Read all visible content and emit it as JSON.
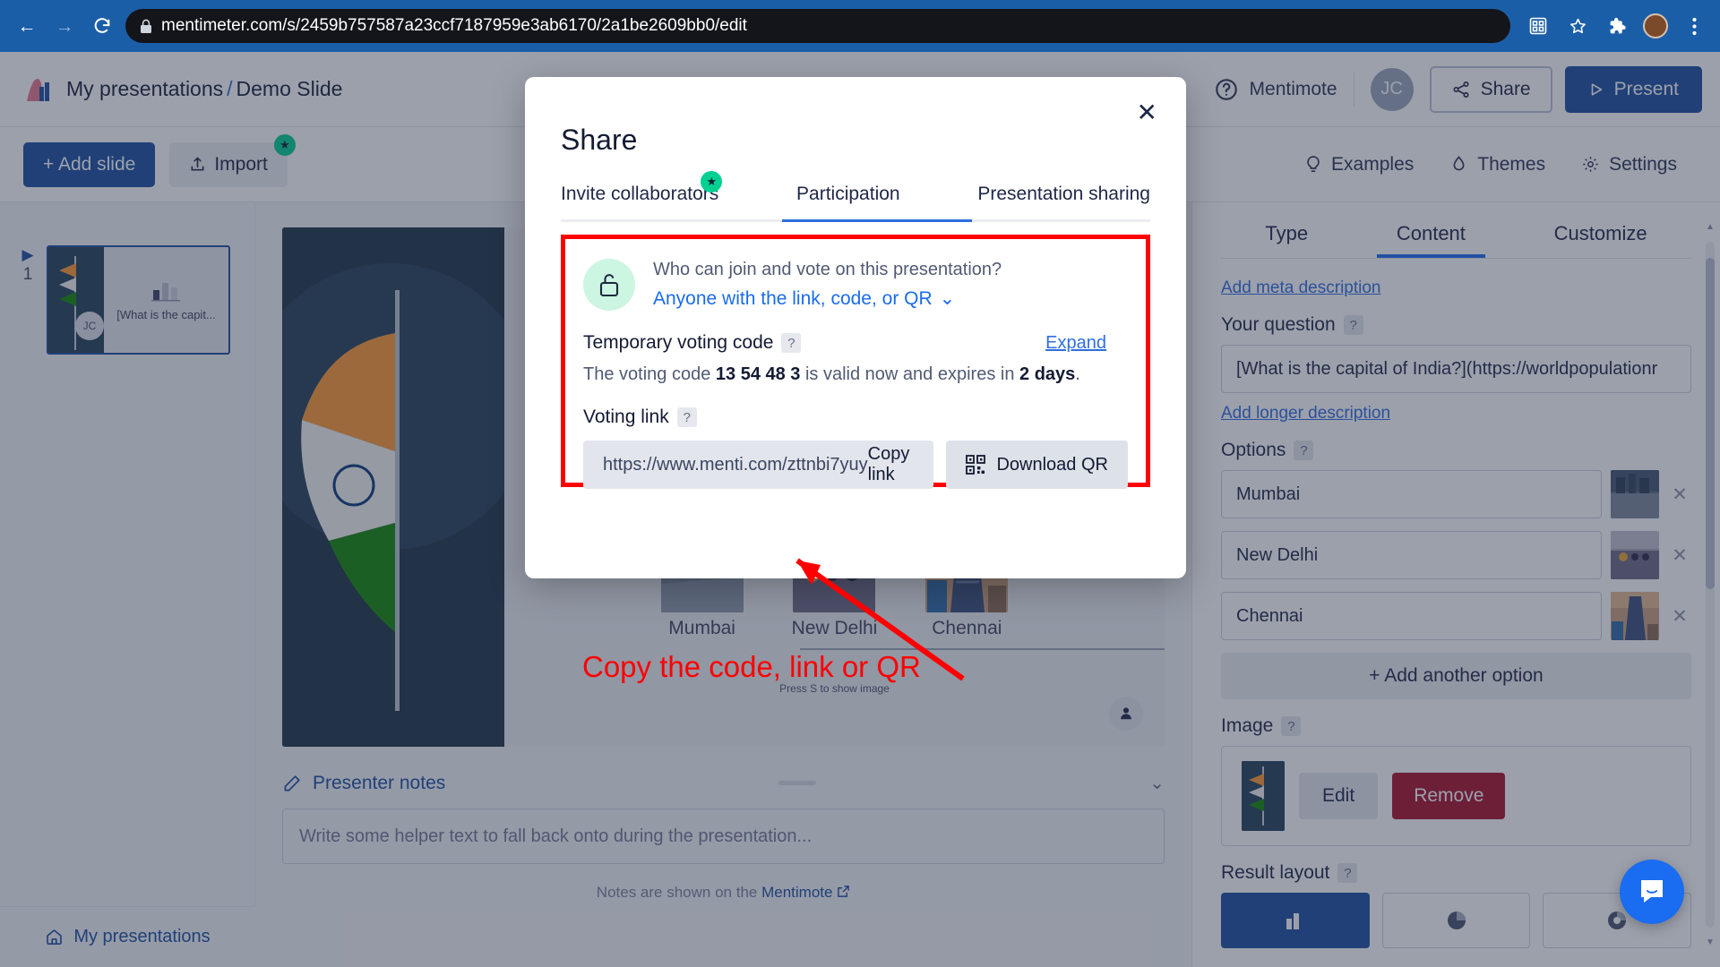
{
  "browser": {
    "url": "mentimeter.com/s/2459b757587a23ccf7187959e3ab6170/2a1be2609bb0/edit",
    "back_label": "←",
    "forward_label": "→",
    "reload_label": "C"
  },
  "header": {
    "breadcrumb_root": "My presentations",
    "breadcrumb_sep": "/",
    "breadcrumb_current": "Demo Slide",
    "mentimote_label": "Mentimote",
    "avatar_initials": "JC",
    "share_label": "Share",
    "present_label": "Present"
  },
  "toolbar": {
    "add_slide_label": "+ Add slide",
    "import_label": "Import",
    "examples_label": "Examples",
    "themes_label": "Themes",
    "settings_label": "Settings"
  },
  "slide_rail": {
    "slide_number": "1",
    "thumb_title": "[What is the capit...",
    "thumb_avatar": "JC",
    "my_presentations_label": "My presentations"
  },
  "editor": {
    "question_link": "[What is the capital of India?](https://worldpopulationreview.com)",
    "options": [
      {
        "label": "Mumbai"
      },
      {
        "label": "New Delhi"
      },
      {
        "label": "Chennai"
      }
    ],
    "press_s_hint": "Press S to show image",
    "notes_title": "Presenter notes",
    "notes_placeholder": "Write some helper text to fall back onto during the presentation...",
    "notes_footer_prefix": "Notes are shown on the",
    "notes_footer_link": "Mentimote"
  },
  "props": {
    "tabs": [
      {
        "label": "Type",
        "active": false
      },
      {
        "label": "Content",
        "active": true
      },
      {
        "label": "Customize",
        "active": false
      }
    ],
    "add_meta_description": "Add meta description",
    "your_question_label": "Your question",
    "your_question_value": "[What is the capital of India?](https://worldpopulationr",
    "add_longer_description": "Add longer description",
    "options_label": "Options",
    "options": [
      {
        "value": "Mumbai"
      },
      {
        "value": "New Delhi"
      },
      {
        "value": "Chennai"
      }
    ],
    "add_another_option": "+ Add another option",
    "image_label": "Image",
    "edit_label": "Edit",
    "remove_label": "Remove",
    "result_layout_label": "Result layout",
    "help_marker": "?"
  },
  "modal": {
    "title": "Share",
    "close_label": "✕",
    "tabs": [
      {
        "label": "Invite collaborators",
        "active": false,
        "badge": "★"
      },
      {
        "label": "Participation",
        "active": true
      },
      {
        "label": "Presentation sharing",
        "active": false
      }
    ],
    "who_question": "Who can join and vote on this presentation?",
    "who_answer": "Anyone with the link, code, or QR",
    "who_chevron": "⌄",
    "voting_code_label": "Temporary voting code",
    "expand_label": "Expand",
    "code_sentence_prefix": "The voting code",
    "code_value": "13 54 48 3",
    "code_sentence_mid": "is valid now and expires in",
    "code_expiry": "2 days",
    "code_sentence_suffix": ".",
    "voting_link_label": "Voting link",
    "voting_link_url": "https://www.menti.com/zttnbi7yuy",
    "copy_link_label": "Copy link",
    "download_qr_label": "Download QR",
    "help_marker": "?"
  },
  "annotation": {
    "text": "Copy the code, link or QR",
    "color": "#ff0000"
  },
  "colors": {
    "browser_blue": "#1b5ea8",
    "brand_blue": "#1a4fa0",
    "link_blue": "#2f6ee0",
    "accent_green": "#00d092",
    "danger_red": "#a8112b",
    "annotation_red": "#ff0000"
  }
}
